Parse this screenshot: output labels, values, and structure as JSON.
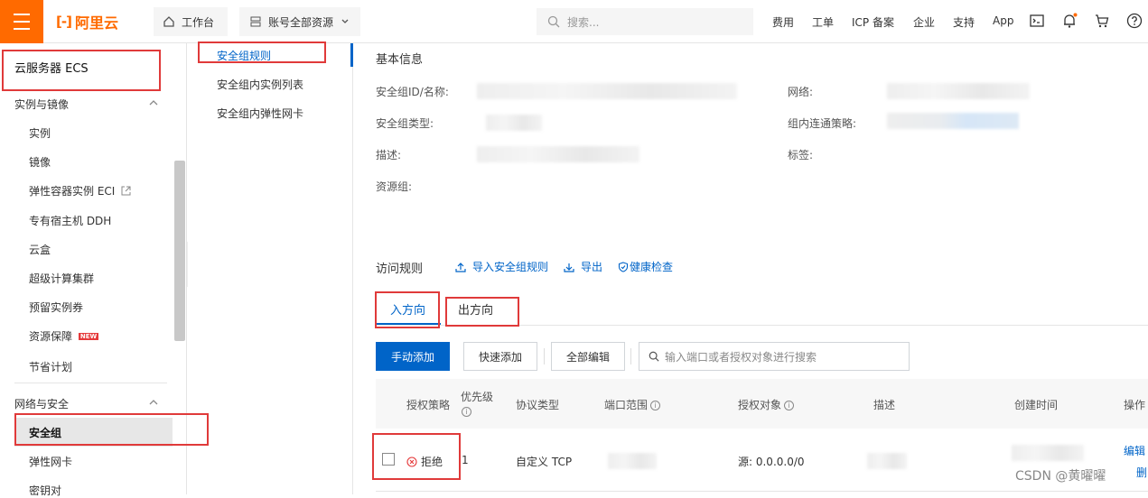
{
  "topbar": {
    "logo_text": "阿里云",
    "workbench": "工作台",
    "resources": "账号全部资源",
    "search_placeholder": "搜索...",
    "links": [
      "费用",
      "工单",
      "ICP 备案",
      "企业",
      "支持",
      "App"
    ]
  },
  "sidebar": {
    "title": "云服务器 ECS",
    "group1": "实例与镜像",
    "group1_items": [
      "实例",
      "镜像",
      "弹性容器实例 ECI",
      "专有宿主机 DDH",
      "云盒",
      "超级计算集群",
      "预留实例券",
      "资源保障",
      "节省计划"
    ],
    "new_badge": "NEW",
    "group2": "网络与安全",
    "group2_items": [
      "安全组",
      "弹性网卡",
      "密钥对"
    ]
  },
  "subnav": {
    "items": [
      "安全组规则",
      "安全组内实例列表",
      "安全组内弹性网卡"
    ]
  },
  "basic": {
    "title": "基本信息",
    "id_label": "安全组ID/名称:",
    "type_label": "安全组类型:",
    "desc_label": "描述:",
    "rg_label": "资源组:",
    "network_label": "网络:",
    "policy_label": "组内连通策略:",
    "tags_label": "标签:"
  },
  "rules": {
    "title": "访问规则",
    "import": "导入安全组规则",
    "export": "导出",
    "health": "健康检查",
    "tab_in": "入方向",
    "tab_out": "出方向",
    "btn_manual": "手动添加",
    "btn_quick": "快速添加",
    "btn_edit_all": "全部编辑",
    "search_placeholder": "输入端口或者授权对象进行搜索"
  },
  "table": {
    "headers": [
      "授权策略",
      "优先级",
      "协议类型",
      "端口范围",
      "授权对象",
      "描述",
      "创建时间",
      "操作"
    ],
    "row": {
      "policy": "拒绝",
      "priority": "1",
      "protocol": "自定义 TCP",
      "source": "源: 0.0.0.0/0",
      "action_edit": "编辑",
      "action_delete": "删"
    }
  },
  "watermark": "CSDN @黄曜曜"
}
